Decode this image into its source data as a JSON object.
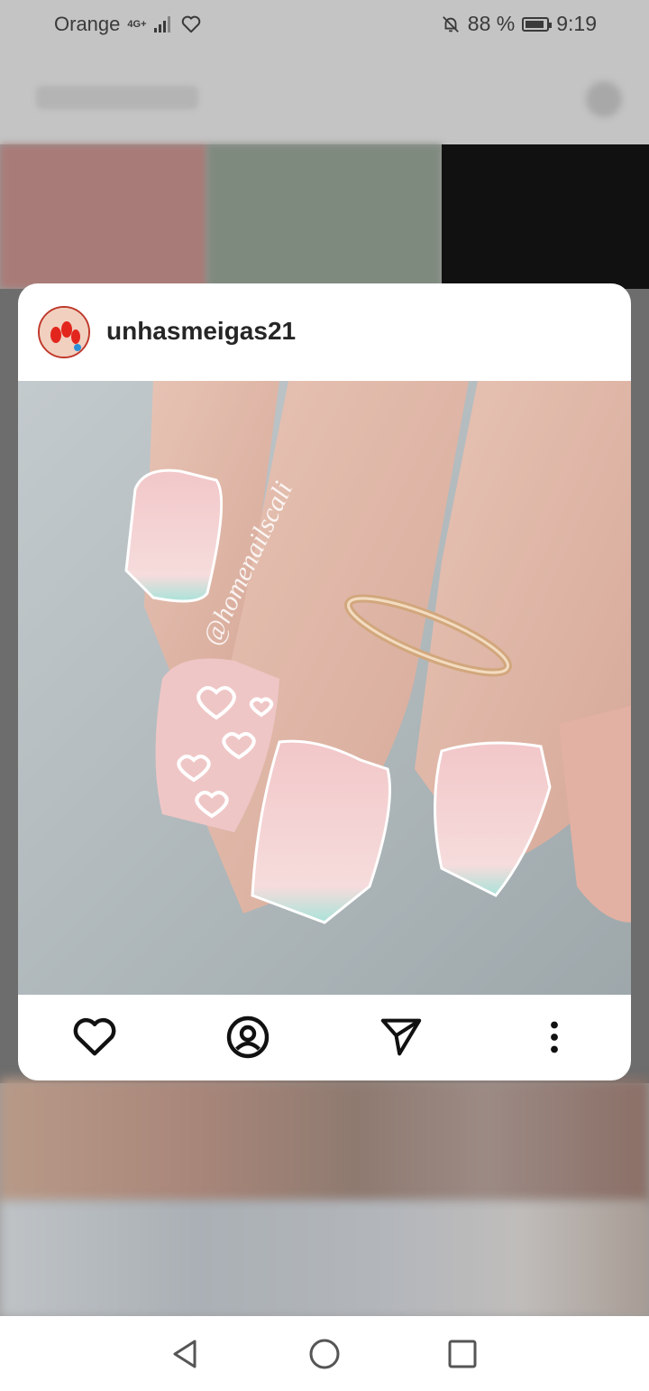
{
  "status_bar": {
    "carrier": "Orange",
    "network": "4G+",
    "battery": "88 %",
    "time": "9:19",
    "icons": [
      "signal-icon",
      "heart-icon",
      "mute-bell-icon",
      "battery-icon"
    ]
  },
  "post": {
    "username": "unhasmeigas21",
    "image_watermark": "@homenailscali",
    "actions": [
      "like-heart-icon",
      "profile-icon",
      "send-icon",
      "more-options-icon"
    ]
  },
  "navigation": {
    "buttons": [
      "back-icon",
      "home-icon",
      "recents-icon"
    ]
  },
  "colors": {
    "card_bg": "#ffffff",
    "accent_avatar_ring": "#c0392b",
    "icon": "#111111"
  }
}
